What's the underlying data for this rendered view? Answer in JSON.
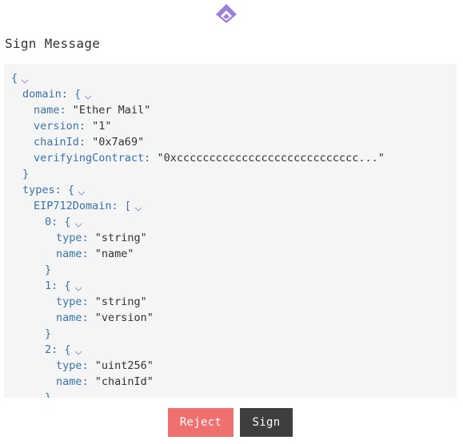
{
  "header": {
    "logo_icon": "wallet-logo-icon",
    "accent": "#9b7fd8"
  },
  "title": "Sign Message",
  "viewer": {
    "lines": [
      {
        "indent": 0,
        "key": "",
        "open": "{",
        "value": "",
        "chev": true
      },
      {
        "indent": 1,
        "key": "domain",
        "open": "{",
        "value": "",
        "chev": true
      },
      {
        "indent": 2,
        "key": "name",
        "open": "",
        "value": "\"Ether Mail\"",
        "chev": false
      },
      {
        "indent": 2,
        "key": "version",
        "open": "",
        "value": "\"1\"",
        "chev": false
      },
      {
        "indent": 2,
        "key": "chainId",
        "open": "",
        "value": "\"0x7a69\"",
        "chev": false
      },
      {
        "indent": 2,
        "key": "verifyingContract",
        "open": "",
        "value": "\"0xcccccccccccccccccccccccccccc...\"",
        "chev": false
      },
      {
        "indent": 1,
        "key": "",
        "open": "}",
        "value": "",
        "chev": false
      },
      {
        "indent": 1,
        "key": "types",
        "open": "{",
        "value": "",
        "chev": true
      },
      {
        "indent": 2,
        "key": "EIP712Domain",
        "open": "[",
        "value": "",
        "chev": true
      },
      {
        "indent": 3,
        "key": "0",
        "open": "{",
        "value": "",
        "chev": true
      },
      {
        "indent": 4,
        "key": "type",
        "open": "",
        "value": "\"string\"",
        "chev": false
      },
      {
        "indent": 4,
        "key": "name",
        "open": "",
        "value": "\"name\"",
        "chev": false
      },
      {
        "indent": 3,
        "key": "",
        "open": "}",
        "value": "",
        "chev": false
      },
      {
        "indent": 3,
        "key": "1",
        "open": "{",
        "value": "",
        "chev": true
      },
      {
        "indent": 4,
        "key": "type",
        "open": "",
        "value": "\"string\"",
        "chev": false
      },
      {
        "indent": 4,
        "key": "name",
        "open": "",
        "value": "\"version\"",
        "chev": false
      },
      {
        "indent": 3,
        "key": "",
        "open": "}",
        "value": "",
        "chev": false
      },
      {
        "indent": 3,
        "key": "2",
        "open": "{",
        "value": "",
        "chev": true
      },
      {
        "indent": 4,
        "key": "type",
        "open": "",
        "value": "\"uint256\"",
        "chev": false
      },
      {
        "indent": 4,
        "key": "name",
        "open": "",
        "value": "\"chainId\"",
        "chev": false
      },
      {
        "indent": 3,
        "key": "",
        "open": "}",
        "value": "",
        "chev": false
      }
    ]
  },
  "actions": {
    "reject_label": "Reject",
    "sign_label": "Sign"
  }
}
